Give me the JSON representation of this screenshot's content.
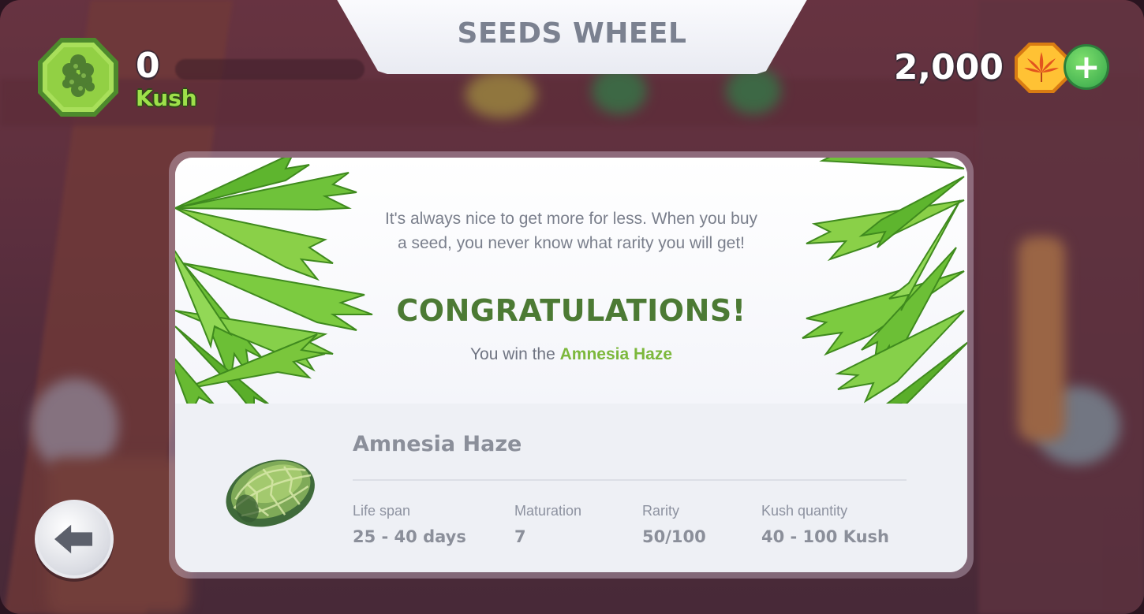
{
  "header": {
    "title": "SEEDS WHEEL",
    "kush_count": "0",
    "kush_label": "Kush",
    "coins": "2,000"
  },
  "card": {
    "description_line1": "It's always nice to get more for less. When you buy",
    "description_line2": "a seed, you never know what rarity you will get!",
    "congrats": "CONGRATULATIONS!",
    "win_prefix": "You win the",
    "win_name": "Amnesia Haze",
    "seed_name": "Amnesia Haze",
    "stats": [
      {
        "label": "Life span",
        "value": "25 - 40 days"
      },
      {
        "label": "Maturation",
        "value": "7"
      },
      {
        "label": "Rarity",
        "value": "50/100"
      },
      {
        "label": "Kush quantity",
        "value": "40 - 100 Kush"
      }
    ]
  },
  "icons": {
    "player": "kush-bud-icon",
    "coin": "coin-leaf-icon",
    "add": "plus-icon",
    "back": "back-arrow-icon",
    "seed": "seed-icon"
  },
  "colors": {
    "accent_green": "#7cb83c",
    "congrats_green": "#4c7a34",
    "kush_green": "#9ee04a",
    "coin_orange": "#f5a623"
  }
}
